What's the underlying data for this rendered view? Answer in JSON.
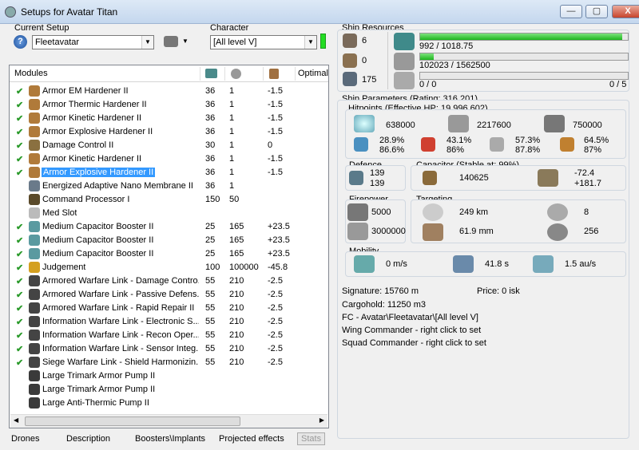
{
  "window": {
    "title": "Setups for Avatar Titan",
    "minimize": "—",
    "maximize": "▢",
    "close": "X"
  },
  "setup": {
    "label": "Current Setup",
    "value": "Fleetavatar"
  },
  "character": {
    "label": "Character",
    "value": "[All level V]"
  },
  "modules": {
    "headers": {
      "name": "Modules",
      "col4": "Optimal"
    },
    "rows": [
      {
        "check": "✔",
        "name": "Armor EM Hardener II",
        "a": "36",
        "b": "1",
        "c": "-1.5",
        "color": "#b07a3a"
      },
      {
        "check": "✔",
        "name": "Armor Thermic Hardener II",
        "a": "36",
        "b": "1",
        "c": "-1.5",
        "color": "#b07a3a"
      },
      {
        "check": "✔",
        "name": "Armor Kinetic Hardener II",
        "a": "36",
        "b": "1",
        "c": "-1.5",
        "color": "#b07a3a"
      },
      {
        "check": "✔",
        "name": "Armor Explosive Hardener II",
        "a": "36",
        "b": "1",
        "c": "-1.5",
        "color": "#b07a3a"
      },
      {
        "check": "✔",
        "name": "Damage Control II",
        "a": "30",
        "b": "1",
        "c": "0",
        "color": "#8a7040"
      },
      {
        "check": "✔",
        "name": "Armor Kinetic Hardener II",
        "a": "36",
        "b": "1",
        "c": "-1.5",
        "color": "#b07a3a"
      },
      {
        "check": "✔",
        "name": "Armor Explosive Hardener II",
        "a": "36",
        "b": "1",
        "c": "-1.5",
        "color": "#b07a3a",
        "selected": true
      },
      {
        "check": "",
        "name": "Energized Adaptive Nano Membrane II",
        "a": "36",
        "b": "1",
        "c": "",
        "color": "#6a7a8a"
      },
      {
        "check": "",
        "name": "Command Processor I",
        "a": "150",
        "b": "50",
        "c": "",
        "color": "#5a4a2a"
      },
      {
        "check": "",
        "name": "Med Slot",
        "a": "",
        "b": "",
        "c": "",
        "color": "#bbbbbb"
      },
      {
        "check": "✔",
        "name": "Medium Capacitor Booster II",
        "a": "25",
        "b": "165",
        "c": "+23.5",
        "color": "#5a9aa0"
      },
      {
        "check": "✔",
        "name": "Medium Capacitor Booster II",
        "a": "25",
        "b": "165",
        "c": "+23.5",
        "color": "#5a9aa0"
      },
      {
        "check": "✔",
        "name": "Medium Capacitor Booster II",
        "a": "25",
        "b": "165",
        "c": "+23.5",
        "color": "#5a9aa0"
      },
      {
        "check": "✔",
        "name": "Judgement",
        "a": "100",
        "b": "100000",
        "c": "-45.8",
        "color": "#d4a020"
      },
      {
        "check": "✔",
        "name": "Armored Warfare Link - Damage Contro...",
        "a": "55",
        "b": "210",
        "c": "-2.5",
        "color": "#444444"
      },
      {
        "check": "✔",
        "name": "Armored Warfare Link - Passive Defens...",
        "a": "55",
        "b": "210",
        "c": "-2.5",
        "color": "#444444"
      },
      {
        "check": "✔",
        "name": "Armored Warfare Link - Rapid Repair II",
        "a": "55",
        "b": "210",
        "c": "-2.5",
        "color": "#444444"
      },
      {
        "check": "✔",
        "name": "Information Warfare Link - Electronic S...",
        "a": "55",
        "b": "210",
        "c": "-2.5",
        "color": "#444444"
      },
      {
        "check": "✔",
        "name": "Information Warfare Link - Recon Oper...",
        "a": "55",
        "b": "210",
        "c": "-2.5",
        "color": "#444444"
      },
      {
        "check": "✔",
        "name": "Information Warfare Link - Sensor Integ...",
        "a": "55",
        "b": "210",
        "c": "-2.5",
        "color": "#444444"
      },
      {
        "check": "✔",
        "name": "Siege Warfare Link - Shield Harmonizin...",
        "a": "55",
        "b": "210",
        "c": "-2.5",
        "color": "#444444"
      },
      {
        "check": "",
        "name": "Large Trimark Armor Pump II",
        "a": "",
        "b": "",
        "c": "",
        "color": "#3a3a3a"
      },
      {
        "check": "",
        "name": "Large Trimark Armor Pump II",
        "a": "",
        "b": "",
        "c": "",
        "color": "#3a3a3a"
      },
      {
        "check": "",
        "name": "Large Anti-Thermic Pump II",
        "a": "",
        "b": "",
        "c": "",
        "color": "#3a3a3a"
      }
    ]
  },
  "tabs": [
    "Drones",
    "Description",
    "Boosters\\Implants",
    "Projected effects",
    "Stats"
  ],
  "resources": {
    "label": "Ship Resources",
    "left": [
      "6",
      "0",
      "175"
    ],
    "cpu_text": "992 / 1018.75",
    "cpu_fill": 0.974,
    "pg_text": "102023 / 1562500",
    "pg_fill": 0.065,
    "drone_left": "0 / 0",
    "drone_right": "0 / 5",
    "drone_fill": 0
  },
  "params": {
    "label": "Ship Parameters (Rating: 316,201)",
    "hitpoints_label": "Hitpoints (Effective HP: 19,996,602)",
    "hp": [
      "638000",
      "2217600",
      "750000"
    ],
    "resists": [
      [
        "28.9%",
        "86.6%"
      ],
      [
        "43.1%",
        "86%"
      ],
      [
        "57.3%",
        "87.8%"
      ],
      [
        "64.5%",
        "87%"
      ]
    ],
    "defence_label": "Defence",
    "defence": [
      "139",
      "139"
    ],
    "capacitor_label": "Capacitor (Stable at: 99%)",
    "cap_amount": "140625",
    "cap_delta": [
      "-72.4",
      "+181.7"
    ],
    "firepower_label": "Firepower",
    "firepower": [
      "5000",
      "3000000"
    ],
    "targeting_label": "Targeting",
    "range": "249 km",
    "targets": "8",
    "sig_res": "61.9 mm",
    "scan_res": "256",
    "mobility_label": "Mobility",
    "velocity": "0 m/s",
    "align": "41.8 s",
    "warp": "1.5 au/s",
    "signature": "Signature: 15760 m",
    "price": "Price: 0 isk",
    "cargohold": "Cargohold: 11250 m3",
    "fc": "FC - Avatar\\Fleetavatar\\[All level V]",
    "wing": "Wing Commander - right click to set",
    "squad": "Squad Commander - right click to set"
  }
}
